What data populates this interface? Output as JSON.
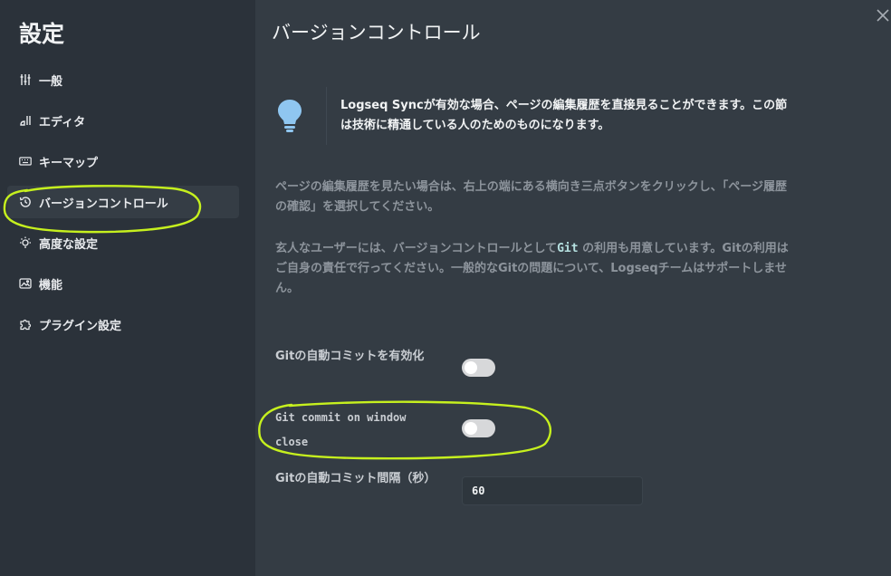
{
  "sidebar": {
    "title": "設定",
    "items": [
      {
        "label": "一般",
        "icon": "sliders-icon"
      },
      {
        "label": "エディタ",
        "icon": "editor-icon"
      },
      {
        "label": "キーマップ",
        "icon": "keyboard-icon"
      },
      {
        "label": "バージョンコントロール",
        "icon": "history-icon",
        "active": true
      },
      {
        "label": "高度な設定",
        "icon": "bulb-icon"
      },
      {
        "label": "機能",
        "icon": "image-icon"
      },
      {
        "label": "プラグイン設定",
        "icon": "puzzle-icon"
      }
    ]
  },
  "main": {
    "title": "バージョンコントロール",
    "tip": "Logseq Syncが有効な場合、ページの編集履歴を直接見ることができます。この節は技術に精通している人のためのものになります。",
    "para1": "ページの編集履歴を見たい場合は、右上の端にある横向き三点ボタンをクリックし、「ページ履歴の確認」を選択してください。",
    "para2_before": "玄人なユーザーには、バージョンコントロールとして",
    "para2_code": "Git",
    "para2_after": " の利用も用意しています。Gitの利用はご自身の責任で行ってください。一般的なGitの問題について、Logseqチームはサポートしません。",
    "settings": {
      "auto_commit_label": "Gitの自動コミットを有効化",
      "auto_commit_on": false,
      "commit_on_close_label": "Git commit on window close",
      "commit_on_close_on": false,
      "interval_label": "Gitの自動コミット間隔（秒）",
      "interval_value": "60"
    }
  },
  "colors": {
    "sidebar_bg": "#2b323a",
    "main_bg": "#343c44",
    "tip_icon": "#8fc6f0",
    "annotation": "#c6f01e"
  }
}
